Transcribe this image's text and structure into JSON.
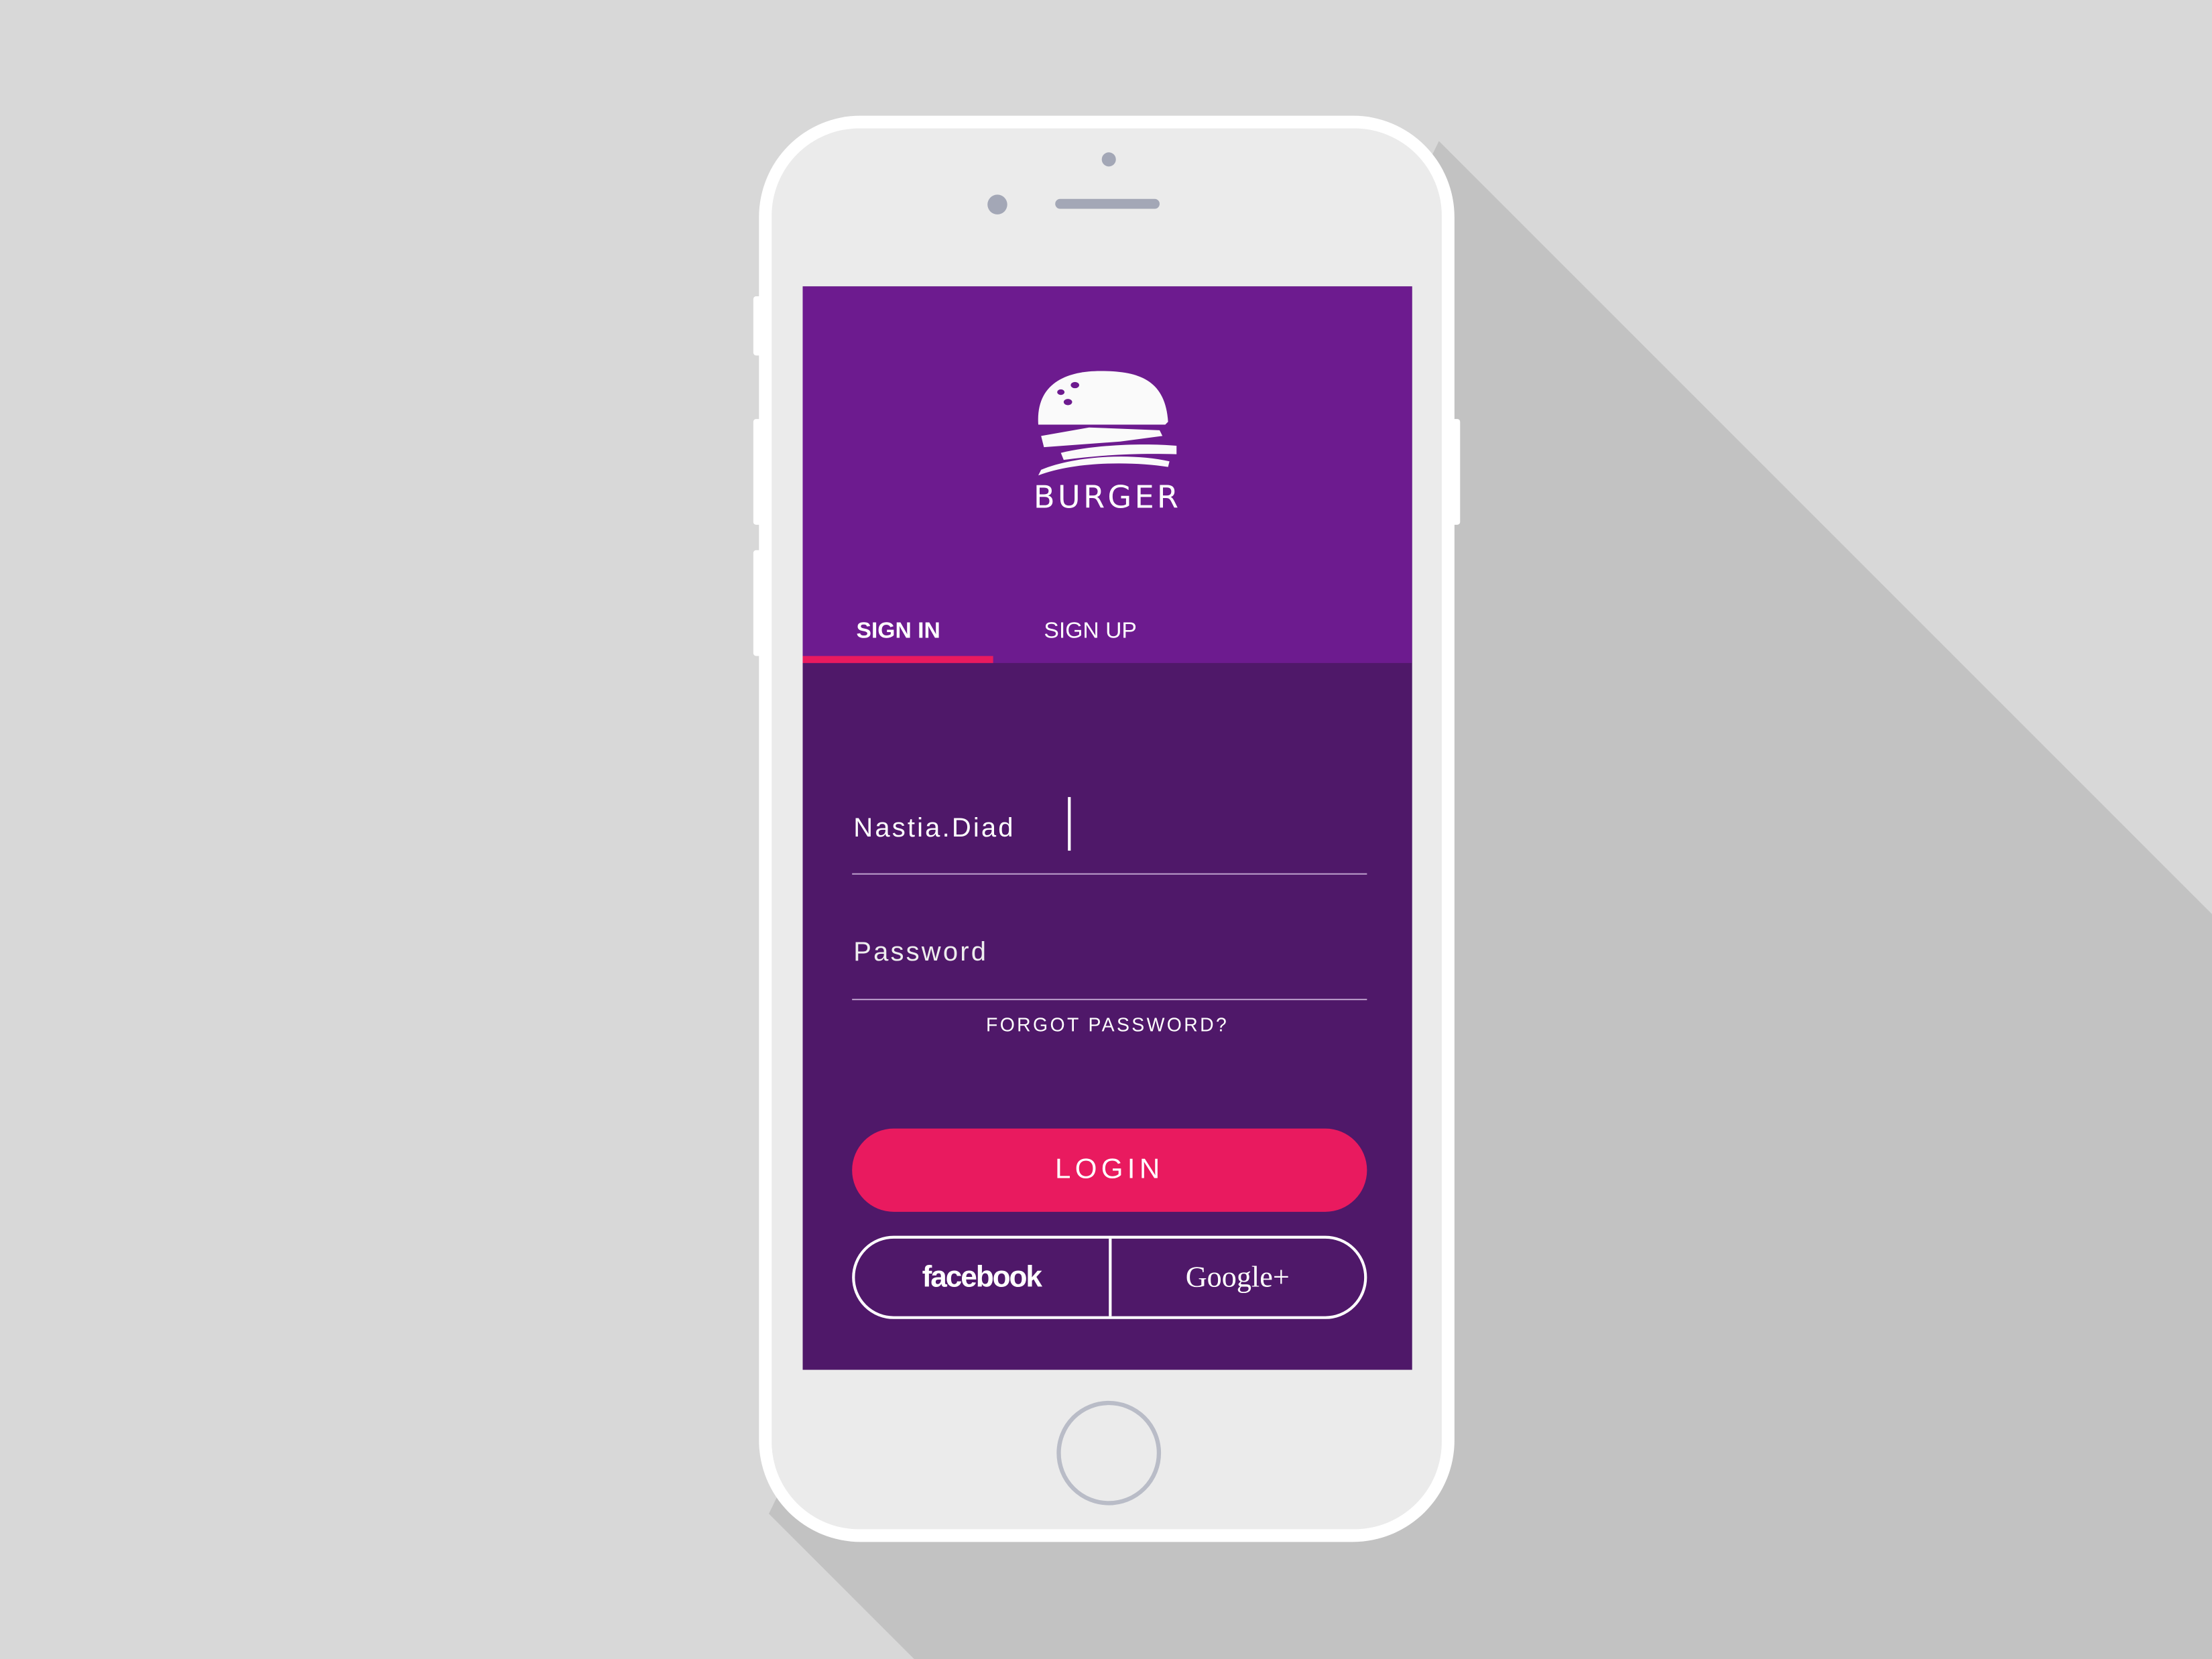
{
  "colors": {
    "header": "#6d1b8f",
    "body": "#4f1869",
    "accent": "#e91a5f",
    "background": "#d8d8d8"
  },
  "app": {
    "brand": "BURGER",
    "logo_icon": "burger-icon"
  },
  "tabs": [
    {
      "label": "SIGN IN",
      "active": true
    },
    {
      "label": "SIGN UP",
      "active": false
    }
  ],
  "form": {
    "username_value": "Nastia.Diad",
    "password_placeholder": "Password",
    "forgot_label": "FORGOT PASSWORD?",
    "login_label": "LOGIN"
  },
  "social": {
    "facebook_label": "facebook",
    "google_label": "Google+"
  }
}
